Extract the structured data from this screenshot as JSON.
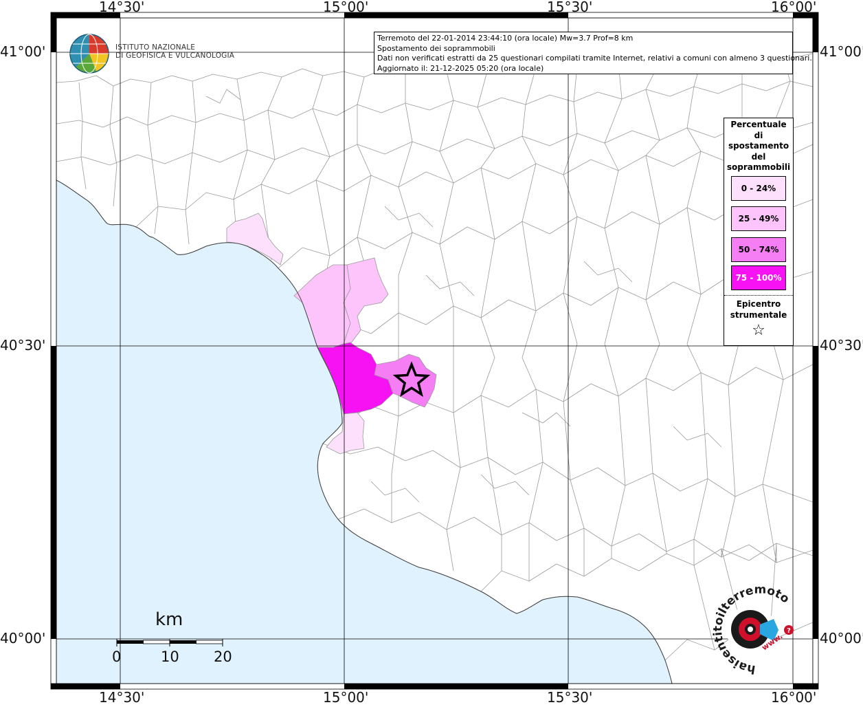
{
  "map": {
    "info_lines": [
      "Terremoto del 22-01-2014 23:44:10 (ora locale) Mw=3.7 Prof=8 km",
      "Spostamento dei soprammobili",
      "Dati non verificati estratti da 25 questionari compilati tramite Internet, relativi a comuni con almeno 3 questionari.",
      "Aggiornato il: 21-12-2025 05:20 (ora locale)"
    ],
    "coords": {
      "top": [
        "14°30'",
        "15°00'",
        "15°30'",
        "16°00'"
      ],
      "bottom": [
        "14°30'",
        "15°00'",
        "15°30'",
        "16°00'"
      ],
      "left": [
        "41°00'",
        "40°30'",
        "40°00'"
      ],
      "right": [
        "41°00'",
        "40°30'",
        "40°00'"
      ]
    },
    "logo_ingv": {
      "line1": "ISTITUTO NAZIONALE",
      "line2": "DI GEOFISICA E VULCANOLOGIA"
    },
    "logo_hst": {
      "text": "haisentitoilterremoto.it",
      "www": "www.",
      "colors": {
        "red": "#d0102a",
        "blue": "#2aa6e0",
        "dark": "#1a1a1a"
      }
    },
    "legend": {
      "title": "Percentuale di spostamento del soprammobili",
      "title_lines": [
        "Percentuale",
        "di",
        "spostamento",
        "del",
        "soprammobili"
      ],
      "classes": [
        {
          "label": "0 - 24%",
          "color": "#fde0fb"
        },
        {
          "label": "25 - 49%",
          "color": "#fcc4fb"
        },
        {
          "label": "50 - 74%",
          "color": "#f57ef5"
        },
        {
          "label": "75 - 100%",
          "color": "#f712f3"
        }
      ],
      "epicenter_lines": [
        "Epicentro",
        "strumentale"
      ],
      "epicenter_symbol": "☆"
    },
    "scale": {
      "unit": "km",
      "ticks": [
        "0",
        "10",
        "20"
      ]
    },
    "colors": {
      "sea": "#e0f2fd",
      "land": "#ffffff",
      "border": "#9a9a9a",
      "grid": "#000000"
    }
  }
}
